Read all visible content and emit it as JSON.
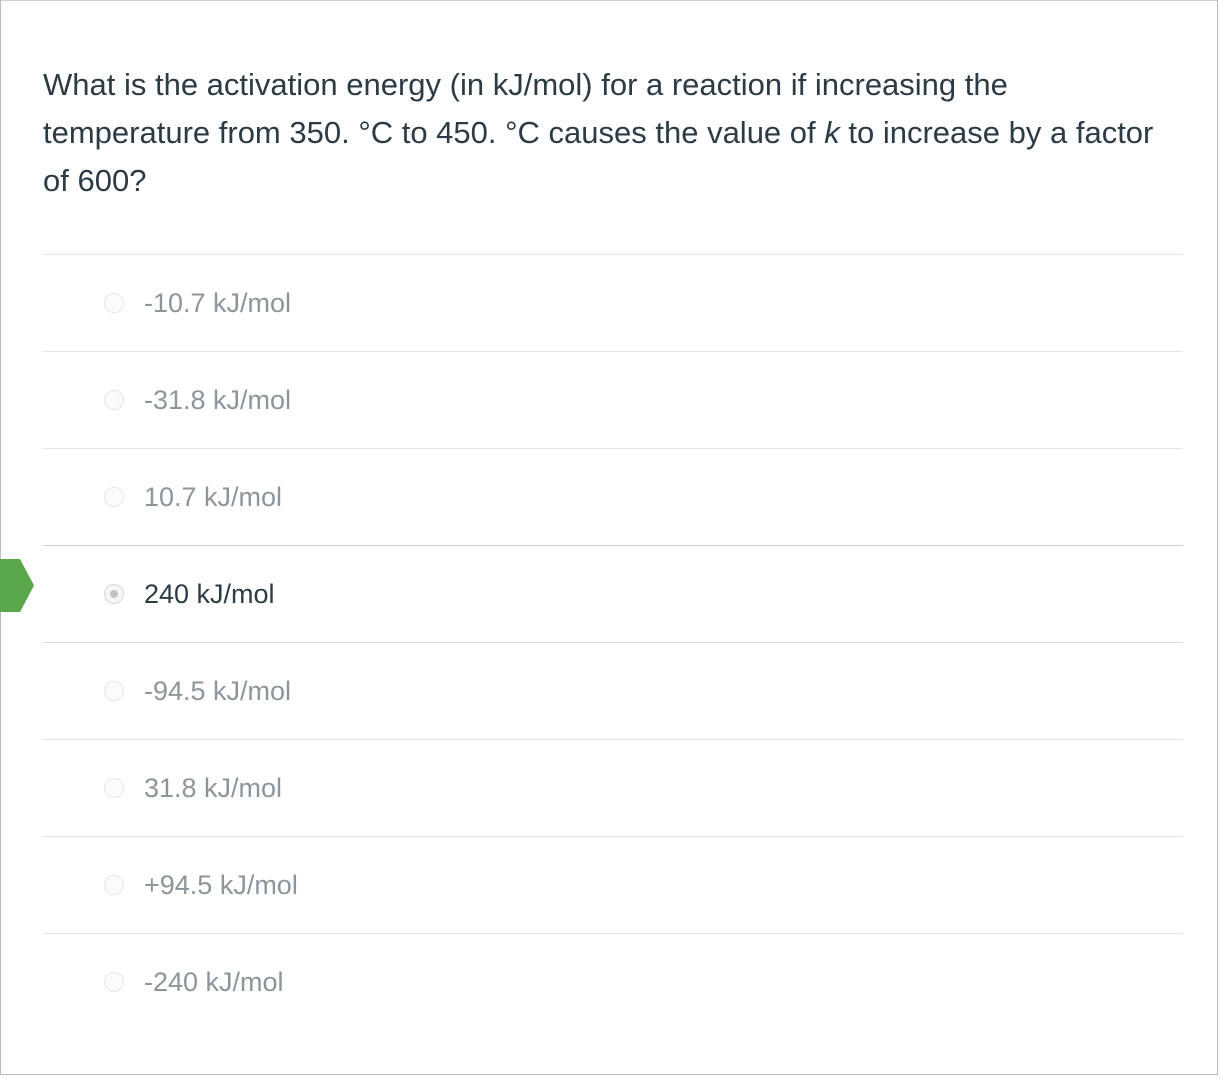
{
  "question": {
    "text_part1": "What is the activation energy (in kJ/mol) for a reaction if increasing the temperature from 350. °C to 450. °C causes the value of ",
    "italic_var": "k",
    "text_part2": " to increase by a factor of 600?"
  },
  "answers": [
    {
      "label": "-10.7 kJ/mol",
      "selected": false
    },
    {
      "label": "-31.8 kJ/mol",
      "selected": false
    },
    {
      "label": "10.7 kJ/mol",
      "selected": false
    },
    {
      "label": "240 kJ/mol",
      "selected": true
    },
    {
      "label": "-94.5 kJ/mol",
      "selected": false
    },
    {
      "label": "31.8 kJ/mol",
      "selected": false
    },
    {
      "label": "+94.5 kJ/mol",
      "selected": false
    },
    {
      "label": "-240 kJ/mol",
      "selected": false
    }
  ],
  "colors": {
    "marker": "#5aa64a",
    "text": "#2d3b45",
    "muted_text": "#8d959b"
  },
  "icons": {
    "selected_marker": "selected-answer-arrow-icon",
    "radio": "radio-button-icon"
  }
}
